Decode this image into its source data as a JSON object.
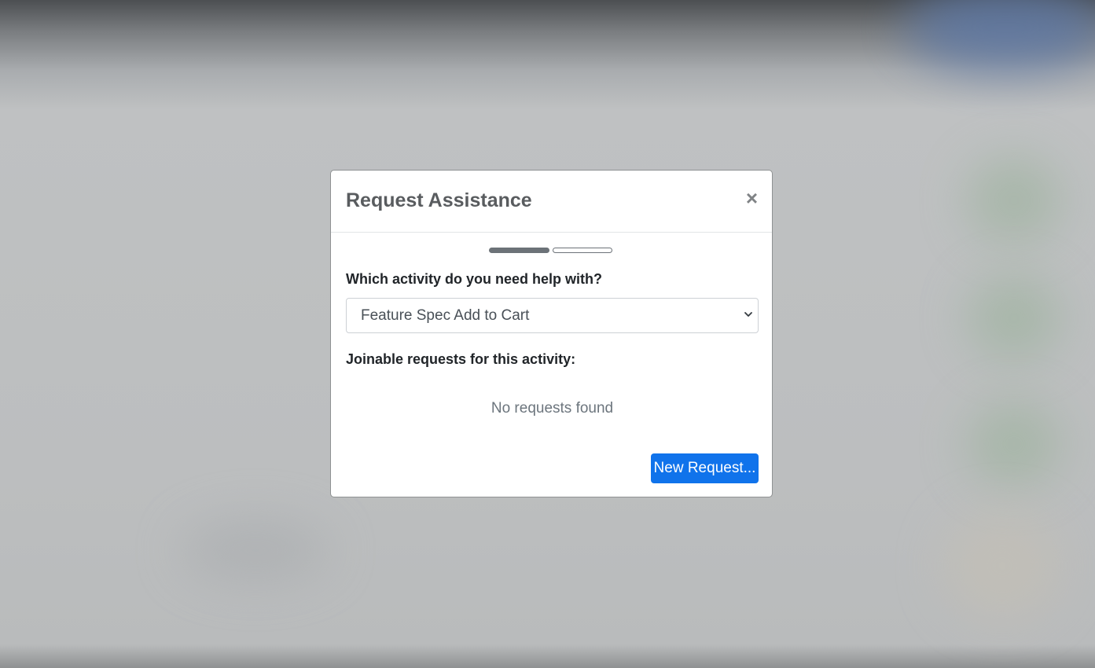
{
  "colors": {
    "primary": "#1073eb",
    "progress_active": "#6c7278",
    "backdrop": "#bfc1c2"
  },
  "modal": {
    "title": "Request Assistance",
    "close_label": "×",
    "close_icon": "close-icon",
    "progress": {
      "total_steps": 2,
      "current_step": 1
    },
    "activity_question": "Which activity do you need help with?",
    "activity_select": {
      "selected": "Feature Spec Add to Cart",
      "icon": "chevron-down-icon"
    },
    "joinable_label": "Joinable requests for this activity:",
    "empty_message": "No requests found",
    "new_request_label": "New Request..."
  }
}
